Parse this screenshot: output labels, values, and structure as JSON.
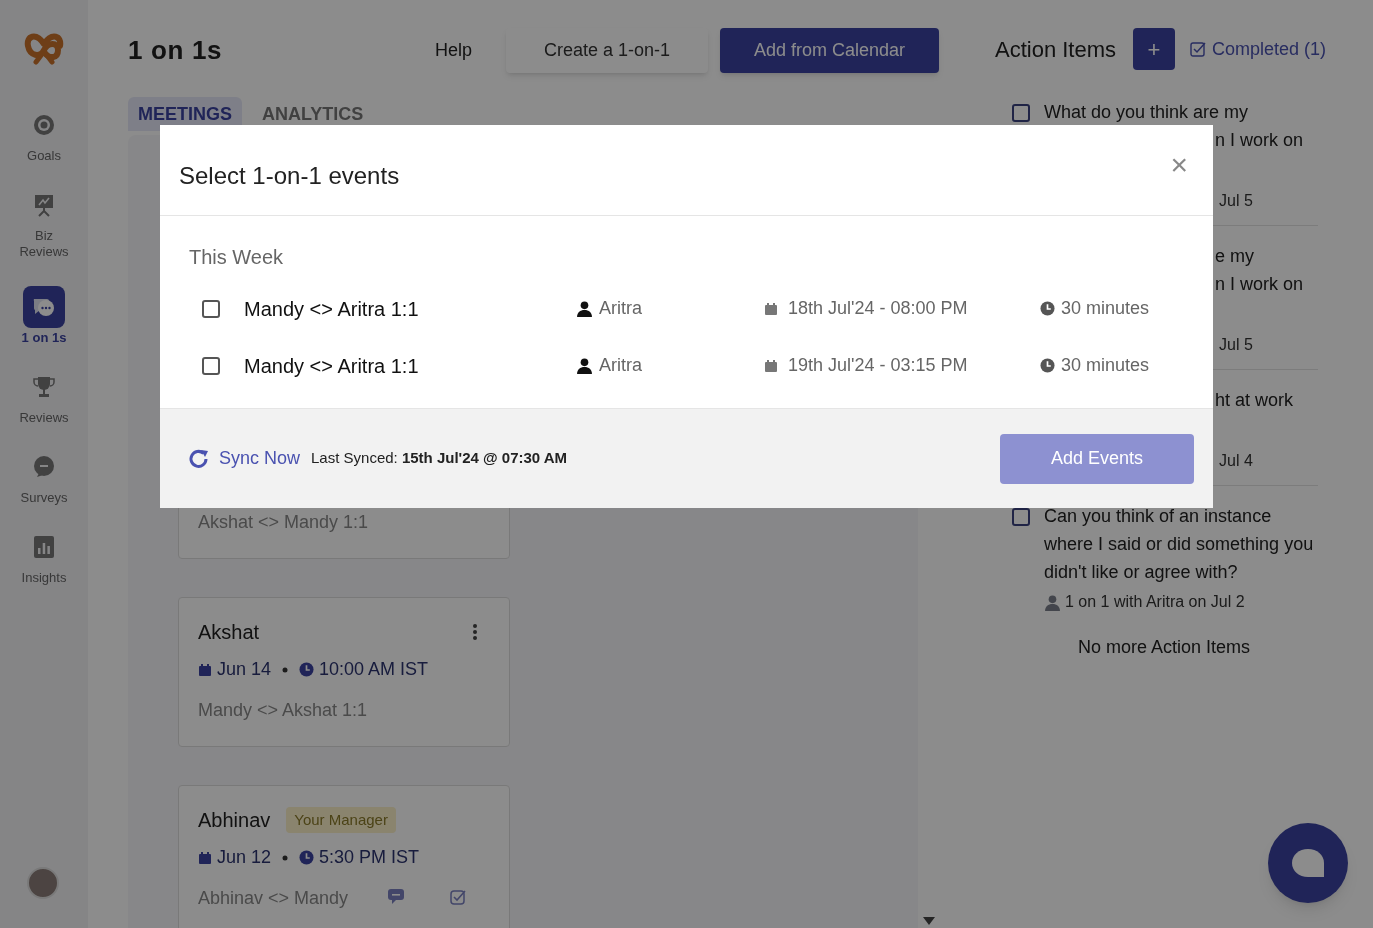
{
  "sidebar": {
    "items": [
      {
        "label": "Goals",
        "selected": false
      },
      {
        "label": "Biz Reviews",
        "selected": false
      },
      {
        "label": "1 on 1s",
        "selected": true
      },
      {
        "label": "Reviews",
        "selected": false
      },
      {
        "label": "Surveys",
        "selected": false
      },
      {
        "label": "Insights",
        "selected": false
      }
    ]
  },
  "header": {
    "title": "1 on 1s",
    "help": "Help",
    "create_button": "Create a 1-on-1",
    "calendar_button": "Add from Calendar"
  },
  "tabs": [
    {
      "label": "MEETINGS",
      "selected": true
    },
    {
      "label": "ANALYTICS",
      "selected": false
    }
  ],
  "meetings": [
    {
      "kind": "partial",
      "description": "Akshat <> Mandy 1:1"
    },
    {
      "kind": "full",
      "name": "Akshat",
      "menu": true,
      "date": "Jun 14",
      "time": "10:00 AM IST",
      "description": "Mandy <> Akshat 1:1"
    },
    {
      "kind": "full",
      "name": "Abhinav",
      "badge": "Your Manager",
      "menu": false,
      "date": "Jun 12",
      "time": "5:30 PM IST",
      "description": "Abhinav <> Mandy",
      "counts": true
    }
  ],
  "action_items": {
    "title": "Action Items",
    "add_button": "+",
    "completed_link": "Completed (1)",
    "items": [
      {
        "kind": "partial",
        "checked": false,
        "lines": [
          {
            "text": "What do you think are my",
            "clipped": false
          },
          {
            "text": "n I work on",
            "clipped": true
          }
        ],
        "meta": "Jul 5"
      },
      {
        "kind": "partial",
        "lines": [
          {
            "text": "e my",
            "clipped": true
          },
          {
            "text": "n I work on",
            "clipped": true
          }
        ],
        "meta": "Jul 5"
      },
      {
        "kind": "partial",
        "lines": [
          {
            "text": "ht at work",
            "clipped": true
          }
        ],
        "meta": "Jul 4"
      },
      {
        "kind": "full",
        "checked": false,
        "lines": [
          {
            "text": "Can you think of an instance",
            "clipped": false
          },
          {
            "text": "where I said or did something you",
            "clipped": false
          },
          {
            "text": "didn't like or agree with?",
            "clipped": false
          }
        ],
        "meta": "1 on 1 with Aritra on Jul 2"
      }
    ],
    "footer": "No more Action Items"
  },
  "modal": {
    "title": "Select 1-on-1 events",
    "close": "×",
    "section": "This Week",
    "events": [
      {
        "checked": false,
        "title": "Mandy <> Aritra 1:1",
        "person": "Aritra",
        "datetime": "18th Jul'24 - 08:00 PM",
        "duration": "30 minutes"
      },
      {
        "checked": false,
        "title": "Mandy <> Aritra 1:1",
        "person": "Aritra",
        "datetime": "19th Jul'24 - 03:15 PM",
        "duration": "30 minutes"
      }
    ],
    "sync_link": "Sync Now",
    "last_synced": "Last Synced: **15th Jul'24 @ 07:30 AM**",
    "add_button": "Add Events",
    "add_disabled": true
  }
}
